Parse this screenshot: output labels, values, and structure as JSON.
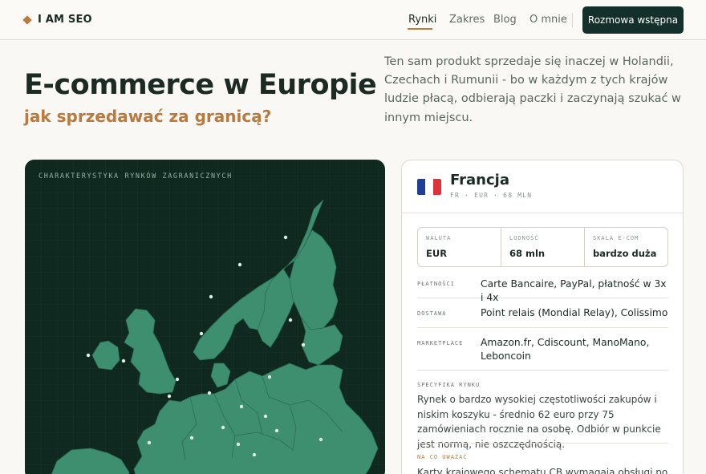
{
  "nav": {
    "brand": "I AM SEO",
    "links": [
      {
        "label": "Rynki",
        "active": true
      },
      {
        "label": "Zakres",
        "active": false
      },
      {
        "label": "Blog",
        "active": false
      },
      {
        "label": "O mnie",
        "active": false
      }
    ],
    "cta": "Rozmowa wstępna"
  },
  "hero": {
    "title": "E-commerce w Europie",
    "subtitle": "jak sprzedawać za granicą?",
    "description": "Ten sam produkt sprzedaje się inaczej w Holandii, Czechach i Rumunii - bo w każdym z tych krajów ludzie płacą, odbierają paczki i zaczynają szukać w innym miejscu."
  },
  "map": {
    "label": "CHARAKTERYSTYKA RYNKÓW ZAGRANICZNYCH"
  },
  "country": {
    "name": "Francja",
    "meta": "FR · EUR · 68 MLN",
    "flag_colors": [
      "#1f3f97",
      "#ffffff",
      "#e0313b"
    ],
    "stats": [
      {
        "label": "WALUTA",
        "value": "EUR"
      },
      {
        "label": "LUDNOŚĆ",
        "value": "68 mln"
      },
      {
        "label": "SKALA E-COM",
        "value": "bardzo duża"
      }
    ],
    "rows": [
      {
        "label": "PŁATNOŚCI",
        "value": "Carte Bancaire, PayPal, płatność w 3x i 4x"
      },
      {
        "label": "DOSTAWA",
        "value": "Point relais (Mondial Relay), Colissimo"
      },
      {
        "label": "MARKETPLACE",
        "value": "Amazon.fr, Cdiscount, ManoMano, Leboncoin"
      }
    ],
    "specifics_label": "SPECYFIKA RYNKU",
    "specifics_text": "Rynek o bardzo wysokiej częstotliwości zakupów i niskim koszyku - średnio 62 euro przy 75 zamówieniach rocznie na osobę. Odbiór w punkcie jest normą, nie oszczędnością.",
    "watch_label": "NA CO UWAŻAĆ",
    "watch_text": "Karty krajowego schematu CB wymagają obsługi po stronie"
  },
  "colors": {
    "accent": "#b87a3f",
    "dark": "#13302a",
    "map_land": "#3d8f70",
    "map_bg": "#102920"
  }
}
